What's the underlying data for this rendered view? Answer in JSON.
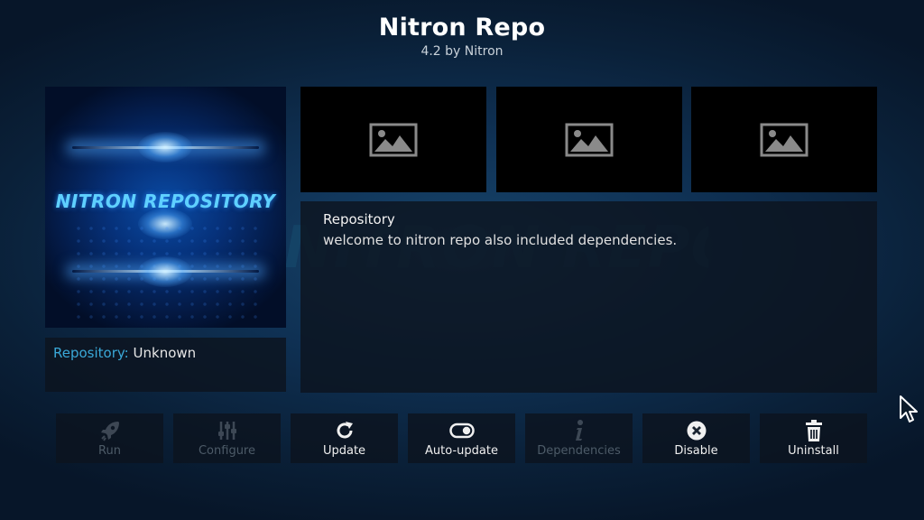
{
  "header": {
    "title": "Nitron Repo",
    "subtitle": "4.2 by Nitron"
  },
  "poster": {
    "logo_text": "NITRON REPOSITORY"
  },
  "background_watermark": "NITRON REPOSITORY",
  "info": {
    "key": "Repository:",
    "value": "Unknown"
  },
  "screenshots": [
    {
      "icon": "image-placeholder-icon"
    },
    {
      "icon": "image-placeholder-icon"
    },
    {
      "icon": "image-placeholder-icon"
    }
  ],
  "description": {
    "title": "Repository",
    "text": "welcome to nitron repo also included dependencies."
  },
  "buttons": [
    {
      "label": "Run",
      "icon": "rocket-icon",
      "enabled": false
    },
    {
      "label": "Configure",
      "icon": "sliders-icon",
      "enabled": false
    },
    {
      "label": "Update",
      "icon": "refresh-icon",
      "enabled": true
    },
    {
      "label": "Auto-update",
      "icon": "toggle-icon",
      "enabled": true
    },
    {
      "label": "Dependencies",
      "icon": "info-icon",
      "enabled": false
    },
    {
      "label": "Disable",
      "icon": "close-circle-icon",
      "enabled": true
    },
    {
      "label": "Uninstall",
      "icon": "trash-icon",
      "enabled": true
    }
  ],
  "colors": {
    "accent_key": "#3aa8d8",
    "disabled_label": "#4d5b68",
    "logo_text": "#5fd0ff"
  }
}
